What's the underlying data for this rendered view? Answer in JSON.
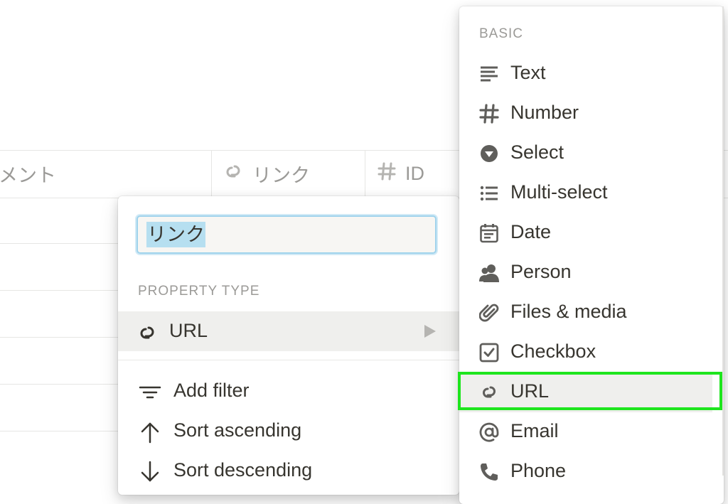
{
  "table": {
    "columns": [
      {
        "label": "メント",
        "icon": "text-lines-icon"
      },
      {
        "label": "リンク",
        "icon": "link-icon"
      },
      {
        "label": "ID",
        "icon": "hash-icon"
      }
    ]
  },
  "property_menu": {
    "name_value": "リンク",
    "property_type_heading": "PROPERTY TYPE",
    "current_type": {
      "label": "URL",
      "icon": "link-icon"
    },
    "actions": [
      {
        "label": "Add filter",
        "icon": "filter-icon"
      },
      {
        "label": "Sort ascending",
        "icon": "arrow-up-icon"
      },
      {
        "label": "Sort descending",
        "icon": "arrow-down-icon"
      }
    ]
  },
  "type_menu": {
    "heading": "BASIC",
    "items": [
      {
        "label": "Text",
        "icon": "text-lines-icon"
      },
      {
        "label": "Number",
        "icon": "hash-icon"
      },
      {
        "label": "Select",
        "icon": "select-circle-icon"
      },
      {
        "label": "Multi-select",
        "icon": "list-icon"
      },
      {
        "label": "Date",
        "icon": "calendar-icon"
      },
      {
        "label": "Person",
        "icon": "person-icon"
      },
      {
        "label": "Files & media",
        "icon": "paperclip-icon"
      },
      {
        "label": "Checkbox",
        "icon": "checkbox-icon"
      },
      {
        "label": "URL",
        "icon": "link-icon"
      },
      {
        "label": "Email",
        "icon": "at-icon"
      },
      {
        "label": "Phone",
        "icon": "phone-icon"
      }
    ],
    "selected": "URL"
  },
  "colors": {
    "icon": "#5f5e5b",
    "muted_text": "#9b9a97",
    "highlight": "#1ee51e",
    "input_selection": "#b6dff0"
  }
}
